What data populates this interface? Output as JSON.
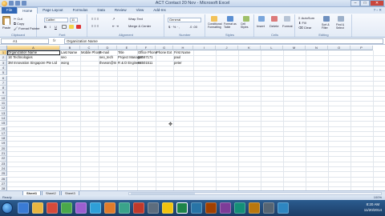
{
  "window": {
    "title": "ACT Contact 20 Nov - Microsoft Excel"
  },
  "tabs": [
    "File",
    "Home",
    "Page Layout",
    "Formulas",
    "Data",
    "Review",
    "View",
    "Add-Ins"
  ],
  "ribbon": {
    "clipboard": {
      "paste": "Paste",
      "label": "Clipboard"
    },
    "font": {
      "name": "Calibri",
      "size": "11",
      "label": "Font"
    },
    "alignment": {
      "wrap": "Wrap Text",
      "merge": "Merge & Center",
      "label": "Alignment"
    },
    "number": {
      "format": "General",
      "label": "Number"
    },
    "styles": {
      "conditional": "Conditional Formatting",
      "format_table": "Format as Table",
      "cell_styles": "Cell Styles",
      "label": "Styles"
    },
    "cells": {
      "insert": "Insert",
      "delete": "Delete",
      "format": "Format",
      "label": "Cells"
    },
    "editing": {
      "autosum": "AutoSum",
      "fill": "Fill",
      "clear": "Clear",
      "sort": "Sort & Filter",
      "find": "Find & Select",
      "label": "Editing"
    }
  },
  "formula_bar": {
    "name_box": "A1",
    "fx": "fx",
    "content": "Organization Name"
  },
  "columns": [
    "A",
    "B",
    "C",
    "D",
    "E",
    "F",
    "G",
    "H",
    "I",
    "J",
    "K",
    "L",
    "M",
    "N",
    "O",
    "P"
  ],
  "rows": [
    "1",
    "2",
    "3",
    "4",
    "5",
    "6",
    "7",
    "8",
    "9",
    "10",
    "11",
    "12",
    "13",
    "14",
    "15",
    "16",
    "17",
    "18",
    "19",
    "20",
    "21",
    "22",
    "23",
    "24",
    "25",
    "26",
    "27",
    "28"
  ],
  "cells": {
    "A1": "Organization Name",
    "B1": "Last Name",
    "C1": "Mobile Phone",
    "D1": "E-mail",
    "E1": "Title",
    "F1": "Office Phone",
    "G1": "Phone Ext",
    "H1": "First Name",
    "A2": "1E Technologies",
    "B2": "seo",
    "D2": "seo_tech",
    "E2": "Project Manager",
    "F2": "62587171",
    "H2": "paul",
    "A3": "3M Innovation Singapore Pte Ltd",
    "B3": "wong",
    "D3": "thewon@m",
    "E3": "R & D Engineer",
    "F3": "64501511",
    "H3": "peter"
  },
  "sheets": [
    "Sheet1",
    "Sheet2",
    "Sheet3"
  ],
  "status": {
    "ready": "Ready",
    "zoom": "100%"
  },
  "taskbar": {
    "time": "8:20 AM",
    "date": "11/20/2014"
  }
}
